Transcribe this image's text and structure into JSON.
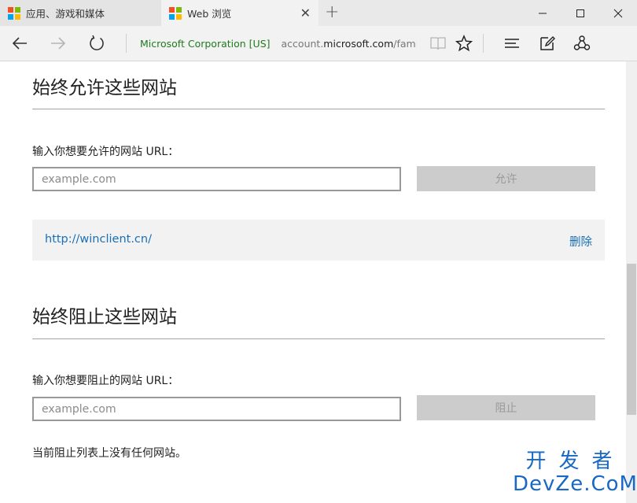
{
  "tabs": [
    {
      "title": "应用、游戏和媒体",
      "active": false
    },
    {
      "title": "Web 浏览",
      "active": true
    }
  ],
  "icons": {
    "tab_close": "close-icon",
    "new_tab": "plus-icon",
    "back": "back-arrow-icon",
    "forward": "forward-arrow-icon",
    "refresh": "refresh-icon",
    "lock": "lock-icon",
    "reading_view": "book-icon",
    "favorite": "star-icon",
    "hub": "hub-icon",
    "web_note": "pen-note-icon",
    "share": "share-icon"
  },
  "window_controls": {
    "minimize": "—",
    "maximize": "☐",
    "close": "✕"
  },
  "address_bar": {
    "certificate": "Microsoft Corporation [US]",
    "url_prefix": "account.",
    "url_domain": "microsoft.com",
    "url_suffix": "/family"
  },
  "allow_section": {
    "heading": "始终允许这些网站",
    "input_label": "输入你想要允许的网站 URL：",
    "input_placeholder": "example.com",
    "button_label": "允许",
    "sites": [
      {
        "url": "http://winclient.cn/",
        "remove_label": "删除"
      }
    ]
  },
  "block_section": {
    "heading": "始终阻止这些网站",
    "input_label": "输入你想要阻止的网站 URL：",
    "input_placeholder": "example.com",
    "button_label": "阻止",
    "empty_message": "当前阻止列表上没有任何网站。"
  },
  "watermark": {
    "line1": "开发者",
    "line2": "DevZe.CoM"
  },
  "colors": {
    "link": "#1a6fb5",
    "cert_green": "#207a1e",
    "disabled_button": "#cccccc",
    "watermark": "#1868c4"
  }
}
